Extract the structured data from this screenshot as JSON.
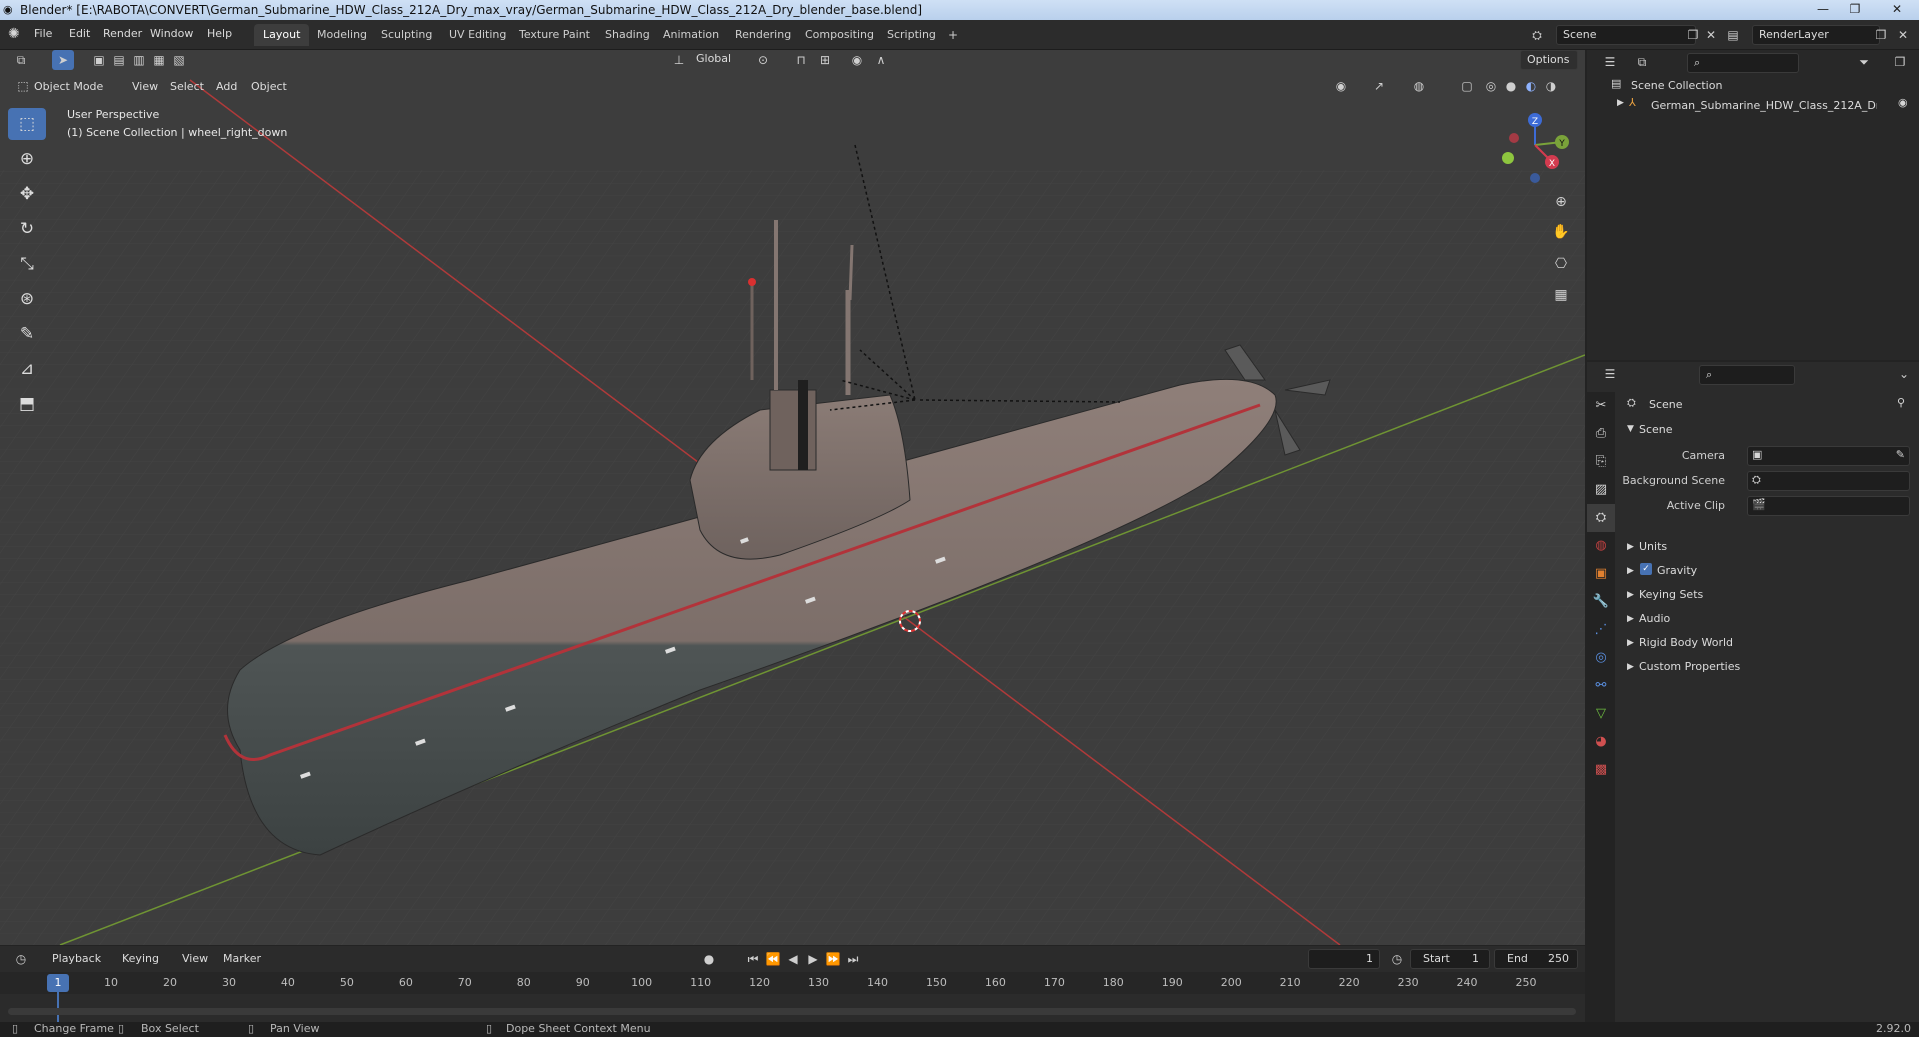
{
  "titlebar": {
    "title": "Blender* [E:\\RABOTA\\CONVERT\\German_Submarine_HDW_Class_212A_Dry_max_vray/German_Submarine_HDW_Class_212A_Dry_blender_base.blend]"
  },
  "menu": [
    "File",
    "Edit",
    "Render",
    "Window",
    "Help"
  ],
  "workspaces": [
    "Layout",
    "Modeling",
    "Sculpting",
    "UV Editing",
    "Texture Paint",
    "Shading",
    "Animation",
    "Rendering",
    "Compositing",
    "Scripting"
  ],
  "scene_field": "Scene",
  "renderlayer_field": "RenderLayer",
  "viewport": {
    "mode": "Object Mode",
    "menus": [
      "View",
      "Select",
      "Add",
      "Object"
    ],
    "transform": "Global",
    "options": "Options",
    "perspective": "User Perspective",
    "collection_info": "(1) Scene Collection | wheel_right_down",
    "gizmo": {
      "z": "Z",
      "y": "Y",
      "x": "X"
    }
  },
  "outliner": {
    "root": "Scene Collection",
    "item": "German_Submarine_HDW_Class_212A_Dry_"
  },
  "properties": {
    "header": "Scene",
    "section": "Scene",
    "camera_label": "Camera",
    "background_label": "Background Scene",
    "clip_label": "Active Clip",
    "panels": [
      "Units",
      "Gravity",
      "Keying Sets",
      "Audio",
      "Rigid Body World",
      "Custom Properties"
    ],
    "gravity_checked": true
  },
  "timeline": {
    "menus": [
      "Playback",
      "Keying",
      "View",
      "Marker"
    ],
    "current_frame": "1",
    "start_label": "Start",
    "start_value": "1",
    "end_label": "End",
    "end_value": "250",
    "ticks": [
      "1",
      "10",
      "20",
      "30",
      "40",
      "50",
      "60",
      "70",
      "80",
      "90",
      "100",
      "110",
      "120",
      "130",
      "140",
      "150",
      "160",
      "170",
      "180",
      "190",
      "200",
      "210",
      "220",
      "230",
      "240",
      "250"
    ]
  },
  "statusbar": {
    "change_frame": "Change Frame",
    "box_select": "Box Select",
    "pan_view": "Pan View",
    "context_menu": "Dope Sheet Context Menu",
    "version": "2.92.0"
  },
  "colors": {
    "accent": "#4772b3",
    "x_axis": "#c23a3a",
    "y_axis": "#7ba33a",
    "hull_top": "#8a7a73",
    "hull_bottom": "#4a4f4f"
  }
}
